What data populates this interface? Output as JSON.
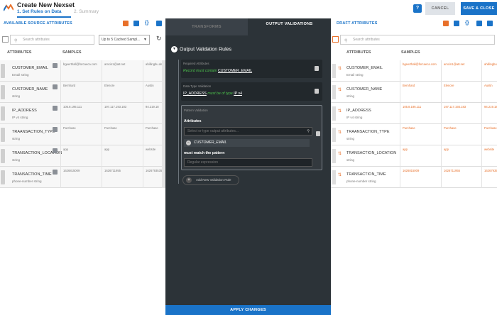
{
  "app": {
    "title": "Create New Nexset",
    "step1": "1. Set Rules on Data",
    "step2": "2. Summary",
    "help": "?",
    "cancel": "CANCEL",
    "save": "SAVE & CLOSE"
  },
  "left": {
    "title": "AVAILABLE SOURCE ATTRIBUTES",
    "search_placeholder": "Search attributes",
    "dropdown": "Up to 5 Cached Sampl...",
    "col_attr": "ATTRIBUTES",
    "col_samples": "SAMPLES"
  },
  "right": {
    "title": "DRAFT ATTRIBUTES",
    "search_placeholder": "Search attributes",
    "col_attr": "ATTRIBUTES",
    "col_samples": "SAMPLES"
  },
  "rows": [
    {
      "name": "CUSTOMER_EMAIL",
      "type": "Email string",
      "s": [
        "bgeerthall@forcaeca.com",
        "amcin1@a8.net",
        "ahillingbu.de"
      ]
    },
    {
      "name": "CUSTOMER_NAME",
      "type": "string",
      "s": [
        "Bernhard",
        "Elenore",
        "Austin"
      ]
    },
    {
      "name": "IP_ADDRESS",
      "type": "IP v4 string",
      "s": [
        "105.8.195.111",
        "197.117.193.183",
        "94.219.18"
      ]
    },
    {
      "name": "TRAANSACTION_TYPE",
      "type": "string",
      "s": [
        "Purchase",
        "Purchase",
        "Purchase"
      ]
    },
    {
      "name": "TRANSACTION_LOCATION",
      "type": "string",
      "s": [
        "app",
        "app",
        "website"
      ]
    },
    {
      "name": "TRANSACTION_TIME",
      "type": "phone-number string",
      "s": [
        "1626815009",
        "1626711955",
        "1626793535"
      ]
    }
  ],
  "center": {
    "tab_transforms": "TRANSFORMS",
    "tab_output": "OUTPUT VALIDATIONS",
    "section_title": "Output Validation Rules",
    "req_title": "Required Attributes",
    "req_text": "Record must contain",
    "req_attr": "CUSTOMER_EMAIL",
    "dt_title": "Data Type Validation",
    "dt_attr": "IP_ADDRESS",
    "dt_text": "must be of type",
    "dt_type": "IP v4",
    "pv_title": "Pattern Validation",
    "pv_attr_label": "Attributes",
    "pv_attr_placeholder": "Select or type output attributes...",
    "pv_tag": "CUSTOMER_EMAIL",
    "pv_match_label": "must match the pattern",
    "pv_regex_placeholder": "Regular expression",
    "add_rule": "Add New Validation Rule",
    "apply": "APPLY CHANGES"
  }
}
